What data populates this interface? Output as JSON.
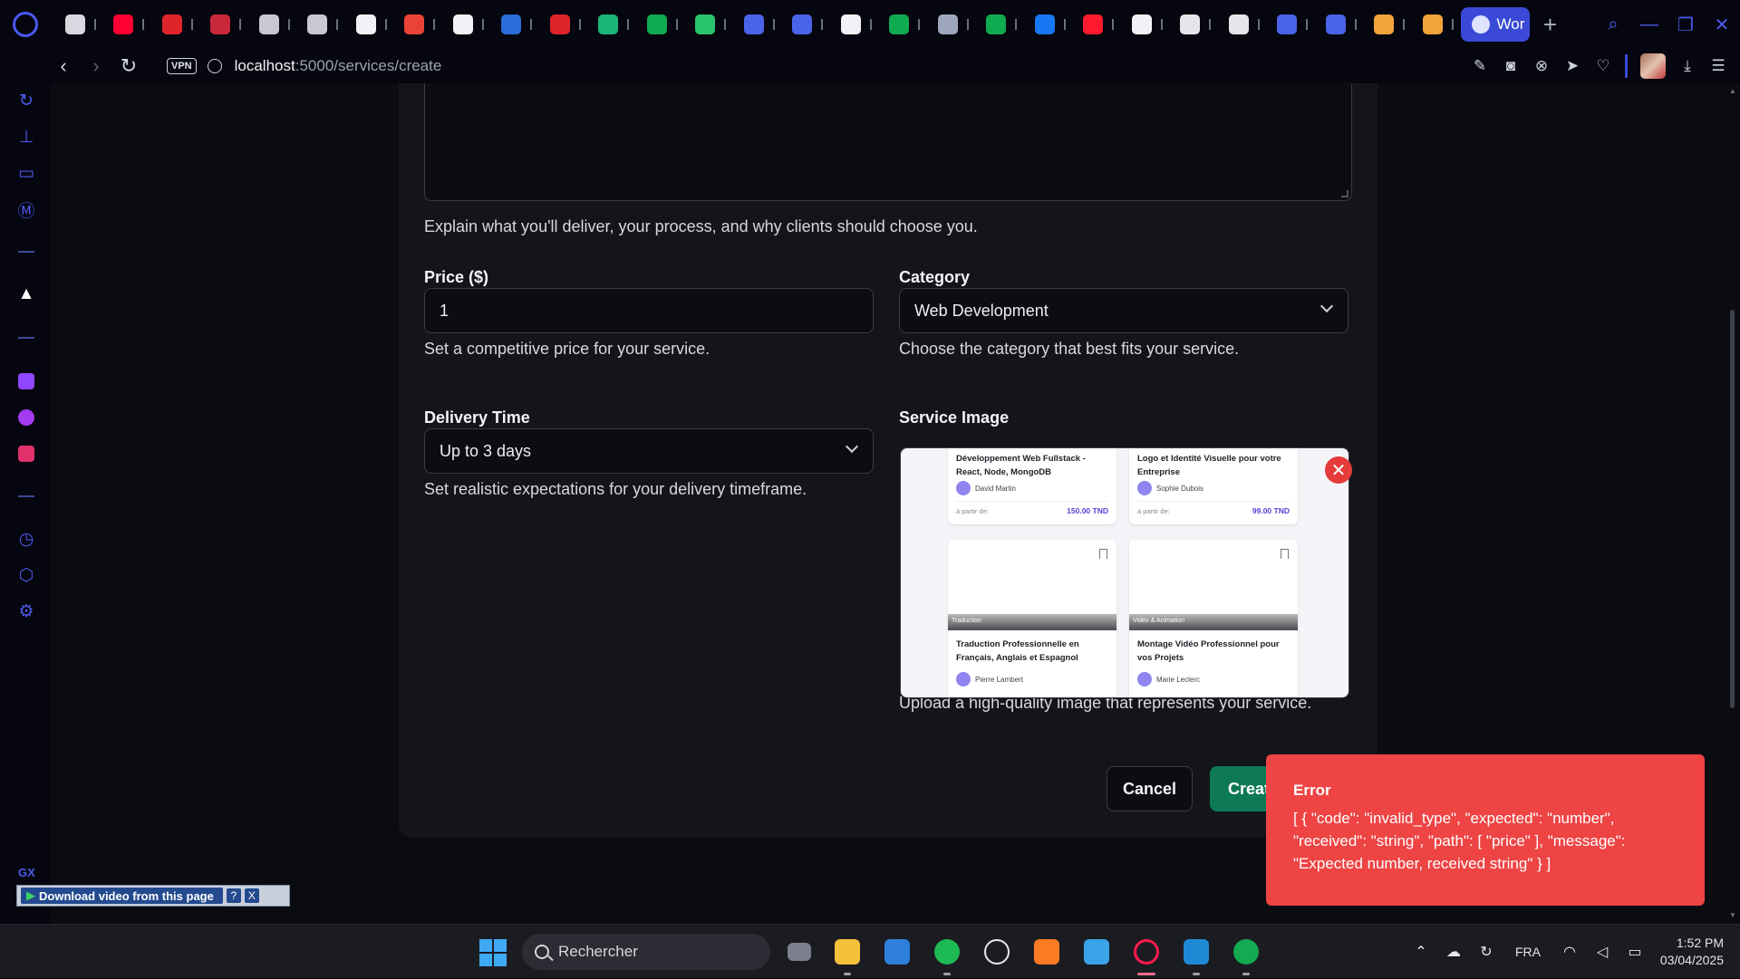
{
  "browser": {
    "active_tab_title": "Wor",
    "url_host": "localhost",
    "url_rest": ":5000/services/create",
    "vpn_label": "VPN",
    "new_tab_symbol": "+",
    "tabs": [
      {
        "icon": "video-editor-icon",
        "color": "#d8d9e0"
      },
      {
        "icon": "youtube-icon",
        "color": "#ff0033"
      },
      {
        "icon": "red-extension-icon",
        "color": "#e0242b"
      },
      {
        "icon": "speedometer-icon",
        "color": "#c9283a"
      },
      {
        "icon": "network-icon",
        "color": "#c8c9d0"
      },
      {
        "icon": "network-icon",
        "color": "#c8c9d0"
      },
      {
        "icon": "mastodon-icon",
        "color": "#f2f2f6"
      },
      {
        "icon": "gmail-icon",
        "color": "#ea4335"
      },
      {
        "icon": "github-icon",
        "color": "#f2f2f6"
      },
      {
        "icon": "word-icon",
        "color": "#2b6cd8"
      },
      {
        "icon": "red-d-icon",
        "color": "#e0242b"
      },
      {
        "icon": "tutor-icon",
        "color": "#1bb679"
      },
      {
        "icon": "mongodb-leaf-icon",
        "color": "#10aa50"
      },
      {
        "icon": "green-arrow-icon",
        "color": "#28c36a"
      },
      {
        "icon": "bird-icon",
        "color": "#4b63e8"
      },
      {
        "icon": "bird-icon",
        "color": "#4b63e8"
      },
      {
        "icon": "code-icon",
        "color": "#f2f2f6"
      },
      {
        "icon": "mongodb-leaf-icon",
        "color": "#10aa50"
      },
      {
        "icon": "wave-icon",
        "color": "#9ea7bd"
      },
      {
        "icon": "mongodb-leaf-icon",
        "color": "#10aa50"
      },
      {
        "icon": "facebook-icon",
        "color": "#1877f2"
      },
      {
        "icon": "opera-icon",
        "color": "#ff1b2d"
      },
      {
        "icon": "b-letter-icon",
        "color": "#f2f2f6"
      },
      {
        "icon": "chatgpt-icon",
        "color": "#e6e6ea"
      },
      {
        "icon": "chatgpt-icon",
        "color": "#e6e6ea"
      },
      {
        "icon": "dot-icon",
        "color": "#4b63e8"
      },
      {
        "icon": "pen-icon",
        "color": "#4b63e8"
      },
      {
        "icon": "apps-icon",
        "color": "#f2a33a"
      },
      {
        "icon": "heart-icon",
        "color": "#f2a33a"
      }
    ],
    "toolbar_icons": [
      "snapshot-edit-icon",
      "camera-icon",
      "shield-x-icon",
      "send-icon",
      "heart-icon",
      "profile-icon",
      "download-icon",
      "menu-icon"
    ]
  },
  "sidebar": {
    "items": [
      "history-refresh-icon",
      "bathtub-icon",
      "tv-icon",
      "gx-m-icon",
      "aria-icon",
      "twitch-icon",
      "messenger-icon",
      "instagram-icon",
      "clock-icon",
      "cube-icon",
      "settings-icon"
    ],
    "gx_label": "GX",
    "colors": {
      "twitch": "#9146ff",
      "messenger": "#a33bf0",
      "instagram": "#e1306c"
    }
  },
  "form": {
    "description_hint": "Explain what you'll deliver, your process, and why clients should choose you.",
    "price": {
      "label": "Price ($)",
      "value": "1",
      "hint": "Set a competitive price for your service."
    },
    "category": {
      "label": "Category",
      "selected": "Web Development",
      "hint": "Choose the category that best fits your service."
    },
    "delivery": {
      "label": "Delivery Time",
      "selected": "Up to 3 days",
      "hint": "Set realistic expectations for your delivery timeframe."
    },
    "image": {
      "label": "Service Image",
      "hint": "Upload a high-quality image that represents your service.",
      "preview_cards": [
        {
          "title": "Développement Web Fullstack - React, Node, MongoDB",
          "author": "David Martin",
          "from_label": "à partir de:",
          "price": "150.00 TND"
        },
        {
          "title": "Logo et Identité Visuelle pour votre Entreprise",
          "author": "Sophie Dubois",
          "from_label": "à partir de:",
          "price": "99.00 TND"
        },
        {
          "tag": "Traduction",
          "title": "Traduction Professionnelle en Français, Anglais et Espagnol",
          "author": "Pierre Lambert"
        },
        {
          "tag": "Vidéo & Animation",
          "title": "Montage Vidéo Professionnel pour vos Projets",
          "author": "Marie Leclerc"
        }
      ],
      "remove_symbol": "✕"
    },
    "buttons": {
      "cancel": "Cancel",
      "create": "Creat"
    }
  },
  "toast": {
    "title": "Error",
    "message": "[ { \"code\": \"invalid_type\", \"expected\": \"number\", \"received\": \"string\", \"path\": [ \"price\" ], \"message\": \"Expected number, received string\" } ]",
    "color": "#ee4444"
  },
  "download_bar": {
    "label": "Download video from this page",
    "help": "?",
    "close": "X"
  },
  "taskbar": {
    "search_placeholder": "Rechercher",
    "apps": [
      "task-view-icon",
      "file-explorer-icon",
      "microsoft-store-icon",
      "spotify-icon",
      "chatgpt-icon",
      "xampp-icon",
      "notepad-icon",
      "opera-gx-icon",
      "vscode-icon",
      "mongodb-compass-icon"
    ],
    "language": "FRA",
    "time": "1:52 PM",
    "date": "03/04/2025"
  }
}
